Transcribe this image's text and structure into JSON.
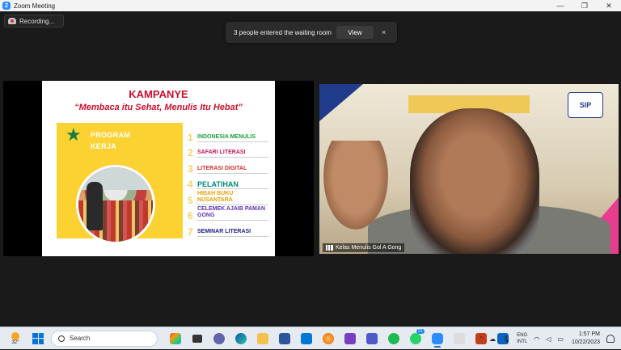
{
  "window": {
    "title": "Zoom Meeting",
    "controls": [
      "—",
      "❐",
      "✕"
    ]
  },
  "recording": {
    "label": "Recording..."
  },
  "notification": {
    "message": "3 people entered the waiting room",
    "view_label": "View",
    "close_label": "×"
  },
  "slide": {
    "title": "KAMPANYE",
    "subtitle": "“Membaca itu Sehat, Menulis Itu Hebat”",
    "program_line1": "PROGRAM",
    "program_line2": "KERJA",
    "items": [
      {
        "num": "1",
        "text": "INDONESIA MENULIS",
        "color": "#1b9e3e"
      },
      {
        "num": "2",
        "text": "SAFARI LITERASI",
        "color": "#c2185b"
      },
      {
        "num": "3",
        "text": "LITERASI DIGITAL",
        "color": "#d32f2f"
      },
      {
        "num": "4",
        "text": "PELATIHAN",
        "color": "#00897b"
      },
      {
        "num": "5",
        "text": "HIBAH BUKU NUSANTARA",
        "color": "#e6a100"
      },
      {
        "num": "6",
        "text": "CELEMEK AJAIB PAMAN GONG",
        "color": "#5e35b1"
      },
      {
        "num": "7",
        "text": "SEMINAR LITERASI",
        "color": "#1a237e"
      }
    ]
  },
  "video": {
    "participant_name": "Kelas Menulis Gol A Gong",
    "logo_text": "SIP"
  },
  "taskbar": {
    "weather": "32°",
    "search_placeholder": "Search",
    "badge_count": "21",
    "lang_top": "ENG",
    "lang_bottom": "INTL",
    "time": "1:57 PM",
    "date": "10/22/2023",
    "tray_chevron": "^"
  },
  "colors": {
    "zoom_blue": "#2d8cff",
    "slide_red": "#c8102e",
    "yellow_panel": "#fcd233"
  }
}
